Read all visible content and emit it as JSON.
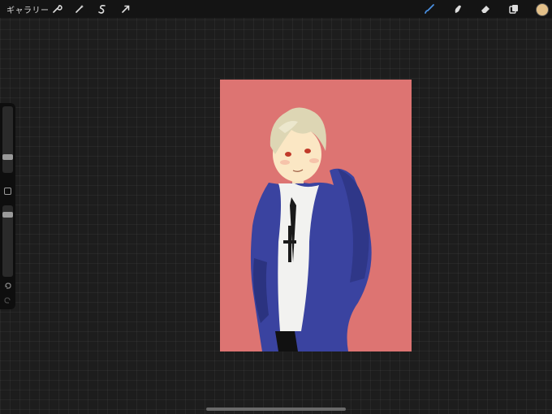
{
  "topbar": {
    "gallery_label": "ギャラリー",
    "left_tools": [
      {
        "name": "actions",
        "icon": "wrench-icon"
      },
      {
        "name": "adjustments",
        "icon": "magic-wand-icon"
      },
      {
        "name": "selection",
        "icon": "selection-s-icon"
      },
      {
        "name": "transform",
        "icon": "arrow-cursor-icon"
      }
    ],
    "right_tools": [
      {
        "name": "brush",
        "icon": "brush-icon",
        "active": true
      },
      {
        "name": "smudge",
        "icon": "smudge-icon"
      },
      {
        "name": "eraser",
        "icon": "eraser-icon"
      },
      {
        "name": "layers",
        "icon": "layers-icon"
      }
    ],
    "current_color": "#e3c089",
    "active_tool_color": "#4a90e2"
  },
  "sidebar": {
    "brush_size_level": 0.22,
    "opacity_level": 0.9,
    "modifier_icon": "square-icon",
    "undo_icon": "undo-icon",
    "redo_icon": "redo-icon"
  },
  "canvas": {
    "background_color": "#dd7472",
    "subject": "artwork"
  },
  "colors": {
    "hood": "#3a43a0",
    "hair": "#ddd6b4",
    "skin": "#fbe7c4",
    "shirt": "#f2f2f0"
  }
}
